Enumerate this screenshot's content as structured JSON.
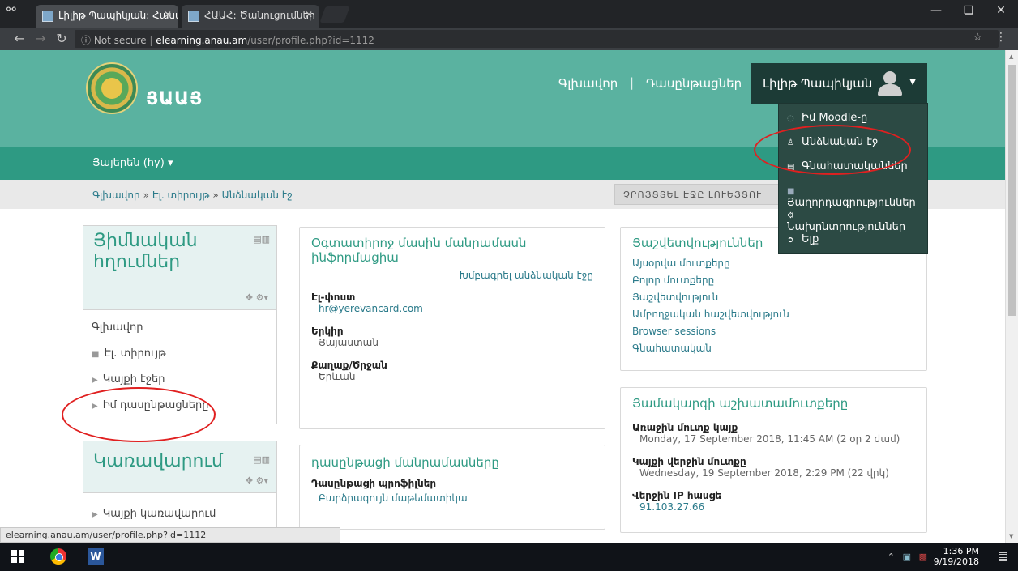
{
  "browser": {
    "tabs": [
      {
        "title": "Լիլիթ Պապիկյան: Հասա"
      },
      {
        "title": "ՀԱԱՀ: Ծանուցումներ"
      }
    ],
    "url_prefix": "Not secure",
    "url_host": "elearning.anau.am",
    "url_path": "/user/profile.php?id=1112",
    "status_url": "elearning.anau.am/user/profile.php?id=1112"
  },
  "header": {
    "site_name": "ՅԱԱՅ",
    "nav": [
      "Գլխավոր",
      "Դասընթացներ"
    ],
    "user_name": "Լիլիթ Պապիկյան",
    "language": "Յայերեն (hy)"
  },
  "breadcrumb": [
    "Գլխավոր",
    "Էլ. տիրույթ",
    "Անձնական էջ"
  ],
  "reset_button": "ՉՐՈՅՑՏԵԼ ԷՋԸ ԼՈՒԵՅՑՈՒ",
  "user_menu": [
    {
      "icon": "moodle-icon",
      "label": "Իմ Moodle-ը"
    },
    {
      "icon": "user-icon",
      "label": "Անձնական էջ"
    },
    {
      "icon": "grades-icon",
      "label": "Գնահատականներ"
    },
    {
      "icon": "messages-icon",
      "label": "Յաղորդագրություններ"
    },
    {
      "icon": "gear-icon",
      "label": "Նախընտրություններ"
    },
    {
      "icon": "logout-icon",
      "label": "Ելք"
    }
  ],
  "nav_block": {
    "title": "Յիմնական հղումներ",
    "items": [
      "Գլխավոր",
      "Էլ. տիրույթ",
      "Կայքի էջեր",
      "Իմ դասընթացները"
    ]
  },
  "admin_block": {
    "title": "Կառավարում",
    "items": [
      "Կայքի կառավարում"
    ]
  },
  "user_details": {
    "title": "Օգտատիրոջ մասին մանրամասն ինֆորմացիա",
    "edit_link": "Խմբագրել անձնական էջը",
    "email_label": "Էլ-փոստ",
    "email": "hr@yerevancard.com",
    "country_label": "Երկիր",
    "country": "Յայաստան",
    "city_label": "Քաղաք/Ծրջան",
    "city": "Երևան"
  },
  "course_details": {
    "title": "դասընթացի մանրամասները",
    "profiles_label": "Դասընթացի պրոֆիլներ",
    "profile": "Բարձրագույն մաթեմատիկա"
  },
  "reports": {
    "title": "Յաշվետվություններ",
    "links": [
      "Այսօրվա մուտքերը",
      "Բոլոր մուտքերը",
      "Յաշվետվություն",
      "Ամբողջական հաշվետվություն",
      "Browser sessions",
      "Գնահատական"
    ]
  },
  "login_activity": {
    "title": "Յամակարգի աշխատամուտքերը",
    "first_access_label": "Առաջին մուտք կայք",
    "first_access": "Monday, 17 September 2018, 11:45 AM  (2 օր 2 ժամ)",
    "last_access_label": "Կայքի վերջին մուտքը",
    "last_access": "Wednesday, 19 September 2018, 2:29 PM  (22 վրկ)",
    "last_ip_label": "Վերջին IP հասցե",
    "last_ip": "91.103.27.66"
  },
  "taskbar": {
    "time": "1:36 PM",
    "date": "9/19/2018"
  }
}
